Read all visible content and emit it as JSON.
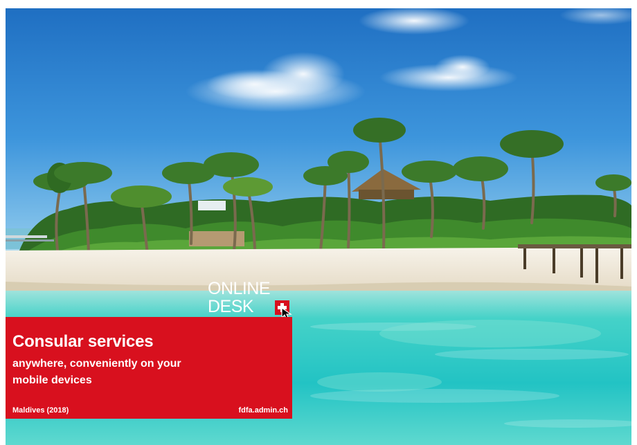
{
  "logo": {
    "line1": "ONLINE",
    "line2": "DESK"
  },
  "promo": {
    "heading": "Consular services",
    "subline1": "anywhere, conveniently on your",
    "subline2": "mobile devices",
    "location": "Maldives (2018)",
    "website": "fdfa.admin.ch"
  },
  "colors": {
    "brand_red": "#d8101e",
    "sky_blue": "#2a78c8",
    "lagoon_turquoise": "#3fd0c8",
    "sand": "#f2ece0"
  },
  "icons": [
    "swiss-cross-icon",
    "cursor-icon"
  ]
}
